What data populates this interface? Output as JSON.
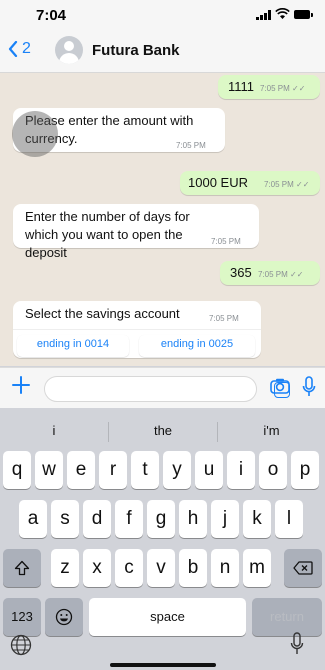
{
  "status_bar": {
    "time": "7:04"
  },
  "header": {
    "back_count": "2",
    "title": "Futura Bank"
  },
  "messages": [
    {
      "dir": "out",
      "text": "1111",
      "time": "7:05 PM"
    },
    {
      "dir": "in",
      "text": "Please enter the amount with currency.",
      "time": "7:05 PM"
    },
    {
      "dir": "out",
      "text": "1000 EUR",
      "time": "7:05 PM"
    },
    {
      "dir": "in",
      "text": "Enter the number of days for which you want to open the deposit",
      "time": "7:05 PM"
    },
    {
      "dir": "out",
      "text": "365",
      "time": "7:05 PM"
    },
    {
      "dir": "in",
      "text": "Select the savings account",
      "time": "7:05 PM"
    }
  ],
  "quick_replies": [
    "ending in 0014",
    "ending in 0025"
  ],
  "input": {
    "placeholder": ""
  },
  "keyboard": {
    "suggestions": [
      "i",
      "the",
      "i'm"
    ],
    "row1": [
      "q",
      "w",
      "e",
      "r",
      "t",
      "y",
      "u",
      "i",
      "o",
      "p"
    ],
    "row2": [
      "a",
      "s",
      "d",
      "f",
      "g",
      "h",
      "j",
      "k",
      "l"
    ],
    "row3": [
      "z",
      "x",
      "c",
      "v",
      "b",
      "n",
      "m"
    ],
    "numbers_label": "123",
    "space_label": "space",
    "return_label": "return"
  },
  "colors": {
    "accent": "#1a82f7",
    "outgoing_bubble": "#dcf8c6",
    "chat_bg": "#ece5dc"
  }
}
